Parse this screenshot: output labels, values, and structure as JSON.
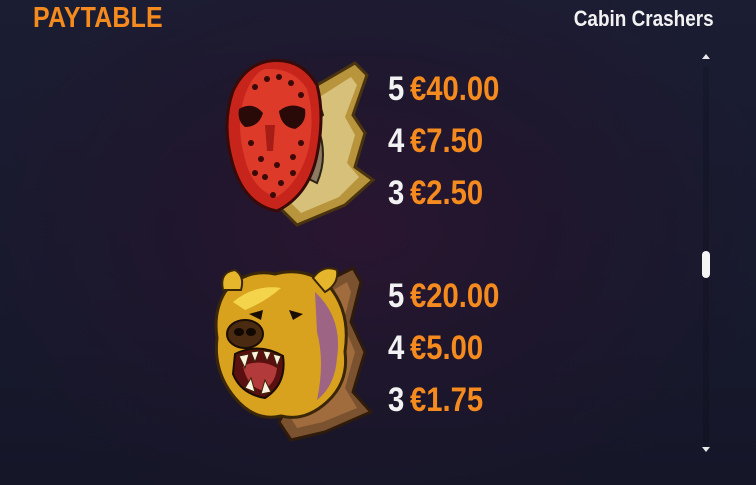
{
  "header": {
    "title": "PAYTABLE",
    "game_name": "Cabin Crashers"
  },
  "symbols": [
    {
      "icon": "hockey-mask-trophy-icon",
      "pays": [
        {
          "count": "5",
          "amount": "€40.00"
        },
        {
          "count": "4",
          "amount": "€7.50"
        },
        {
          "count": "3",
          "amount": "€2.50"
        }
      ]
    },
    {
      "icon": "bear-head-trophy-icon",
      "pays": [
        {
          "count": "5",
          "amount": "€20.00"
        },
        {
          "count": "4",
          "amount": "€5.00"
        },
        {
          "count": "3",
          "amount": "€1.75"
        }
      ]
    }
  ],
  "scrollbar": {
    "icons": [
      "scroll-up-arrow-icon",
      "scroll-down-arrow-icon"
    ]
  },
  "colors": {
    "accent": "#f58a1f",
    "text": "#f2f2f2",
    "background": "#1b1d33"
  }
}
